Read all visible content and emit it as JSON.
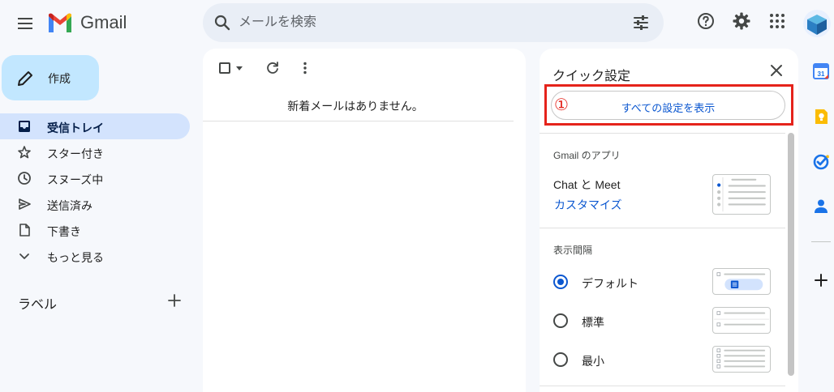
{
  "app": {
    "name": "Gmail"
  },
  "search": {
    "placeholder": "メールを検索"
  },
  "compose": {
    "label": "作成"
  },
  "nav": {
    "items": [
      {
        "label": "受信トレイ",
        "icon": "inbox-icon",
        "active": true
      },
      {
        "label": "スター付き",
        "icon": "star-icon"
      },
      {
        "label": "スヌーズ中",
        "icon": "clock-icon"
      },
      {
        "label": "送信済み",
        "icon": "send-icon"
      },
      {
        "label": "下書き",
        "icon": "draft-icon"
      },
      {
        "label": "もっと見る",
        "icon": "chevron-down-icon"
      }
    ],
    "labels_heading": "ラベル"
  },
  "mail_list": {
    "empty_message": "新着メールはありません。"
  },
  "quick_settings": {
    "title": "クイック設定",
    "annotation_number": "①",
    "see_all_button": "すべての設定を表示",
    "apps_section": {
      "title": "Gmail のアプリ",
      "app_label": "Chat と Meet",
      "customize_link": "カスタマイズ"
    },
    "density_section": {
      "title": "表示間隔",
      "options": [
        {
          "label": "デフォルト",
          "selected": true
        },
        {
          "label": "標準",
          "selected": false
        },
        {
          "label": "最小",
          "selected": false
        }
      ]
    }
  },
  "side_rail": {
    "calendar_day": "31"
  },
  "colors": {
    "accent": "#0b57d0",
    "highlight": "#e5231b",
    "compose_bg": "#c2e7ff",
    "active_nav": "#d3e3fd"
  }
}
